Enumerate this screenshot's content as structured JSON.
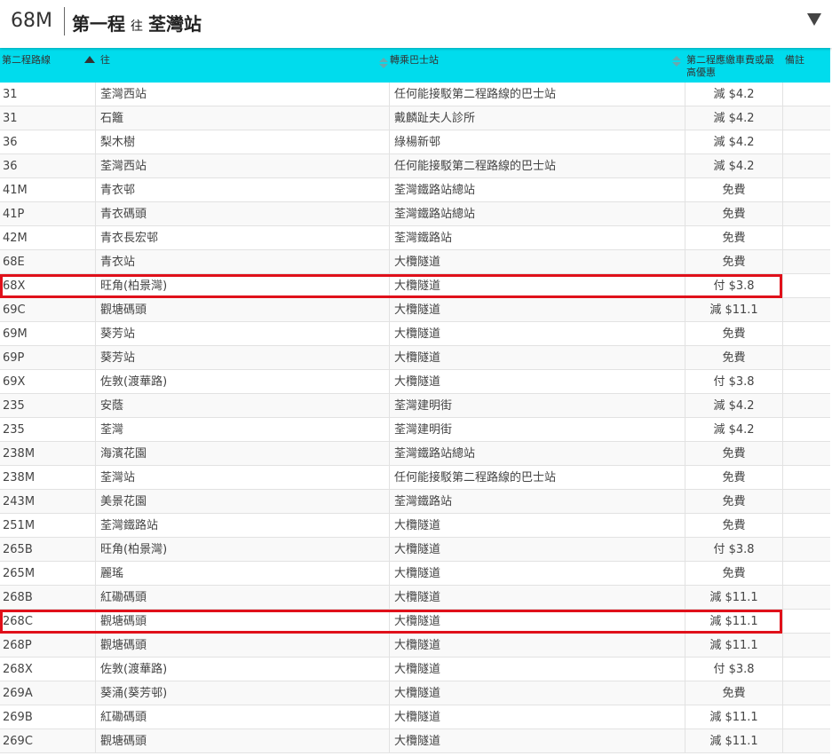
{
  "header": {
    "route_code": "68M",
    "title": "第一程",
    "direction_word": "往",
    "destination": "荃灣站"
  },
  "columns": {
    "route": "第二程路線",
    "dest": "往",
    "stop": "轉乘巴士站",
    "fare": "第二程應繳車費或最高優惠",
    "note": "備註"
  },
  "rows": [
    {
      "route": "31",
      "dest": "荃灣西站",
      "stop": "任何能接駁第二程路線的巴士站",
      "fare": "減 $4.2",
      "note": ""
    },
    {
      "route": "31",
      "dest": "石籬",
      "stop": "戴麟趾夫人診所",
      "fare": "減 $4.2",
      "note": ""
    },
    {
      "route": "36",
      "dest": "梨木樹",
      "stop": "綠楊新邨",
      "fare": "減 $4.2",
      "note": ""
    },
    {
      "route": "36",
      "dest": "荃灣西站",
      "stop": "任何能接駁第二程路線的巴士站",
      "fare": "減 $4.2",
      "note": ""
    },
    {
      "route": "41M",
      "dest": "青衣邨",
      "stop": "荃灣鐵路站總站",
      "fare": "免費",
      "note": ""
    },
    {
      "route": "41P",
      "dest": "青衣碼頭",
      "stop": "荃灣鐵路站總站",
      "fare": "免費",
      "note": ""
    },
    {
      "route": "42M",
      "dest": "青衣長宏邨",
      "stop": "荃灣鐵路站",
      "fare": "免費",
      "note": ""
    },
    {
      "route": "68E",
      "dest": "青衣站",
      "stop": "大欖隧道",
      "fare": "免費",
      "note": ""
    },
    {
      "route": "68X",
      "dest": "旺角(柏景灣)",
      "stop": "大欖隧道",
      "fare": "付 $3.8",
      "note": "",
      "highlight": true
    },
    {
      "route": "69C",
      "dest": "觀塘碼頭",
      "stop": "大欖隧道",
      "fare": "減 $11.1",
      "note": ""
    },
    {
      "route": "69M",
      "dest": "葵芳站",
      "stop": "大欖隧道",
      "fare": "免費",
      "note": ""
    },
    {
      "route": "69P",
      "dest": "葵芳站",
      "stop": "大欖隧道",
      "fare": "免費",
      "note": ""
    },
    {
      "route": "69X",
      "dest": "佐敦(渡華路)",
      "stop": "大欖隧道",
      "fare": "付 $3.8",
      "note": ""
    },
    {
      "route": "235",
      "dest": "安蔭",
      "stop": "荃灣建明街",
      "fare": "減 $4.2",
      "note": ""
    },
    {
      "route": "235",
      "dest": "荃灣",
      "stop": "荃灣建明街",
      "fare": "減 $4.2",
      "note": ""
    },
    {
      "route": "238M",
      "dest": "海濱花園",
      "stop": "荃灣鐵路站總站",
      "fare": "免費",
      "note": ""
    },
    {
      "route": "238M",
      "dest": "荃灣站",
      "stop": "任何能接駁第二程路線的巴士站",
      "fare": "免費",
      "note": ""
    },
    {
      "route": "243M",
      "dest": "美景花園",
      "stop": "荃灣鐵路站",
      "fare": "免費",
      "note": ""
    },
    {
      "route": "251M",
      "dest": "荃灣鐵路站",
      "stop": "大欖隧道",
      "fare": "免費",
      "note": ""
    },
    {
      "route": "265B",
      "dest": "旺角(柏景灣)",
      "stop": "大欖隧道",
      "fare": "付 $3.8",
      "note": ""
    },
    {
      "route": "265M",
      "dest": "麗瑤",
      "stop": "大欖隧道",
      "fare": "免費",
      "note": ""
    },
    {
      "route": "268B",
      "dest": "紅磡碼頭",
      "stop": "大欖隧道",
      "fare": "減 $11.1",
      "note": ""
    },
    {
      "route": "268C",
      "dest": "觀塘碼頭",
      "stop": "大欖隧道",
      "fare": "減 $11.1",
      "note": "",
      "highlight": true
    },
    {
      "route": "268P",
      "dest": "觀塘碼頭",
      "stop": "大欖隧道",
      "fare": "減 $11.1",
      "note": ""
    },
    {
      "route": "268X",
      "dest": "佐敦(渡華路)",
      "stop": "大欖隧道",
      "fare": "付 $3.8",
      "note": ""
    },
    {
      "route": "269A",
      "dest": "葵涌(葵芳邨)",
      "stop": "大欖隧道",
      "fare": "免費",
      "note": ""
    },
    {
      "route": "269B",
      "dest": "紅磡碼頭",
      "stop": "大欖隧道",
      "fare": "減 $11.1",
      "note": ""
    },
    {
      "route": "269C",
      "dest": "觀塘碼頭",
      "stop": "大欖隧道",
      "fare": "減 $11.1",
      "note": ""
    }
  ],
  "colors": {
    "header_bar": "#00dced",
    "highlight_border": "#e0101a"
  }
}
